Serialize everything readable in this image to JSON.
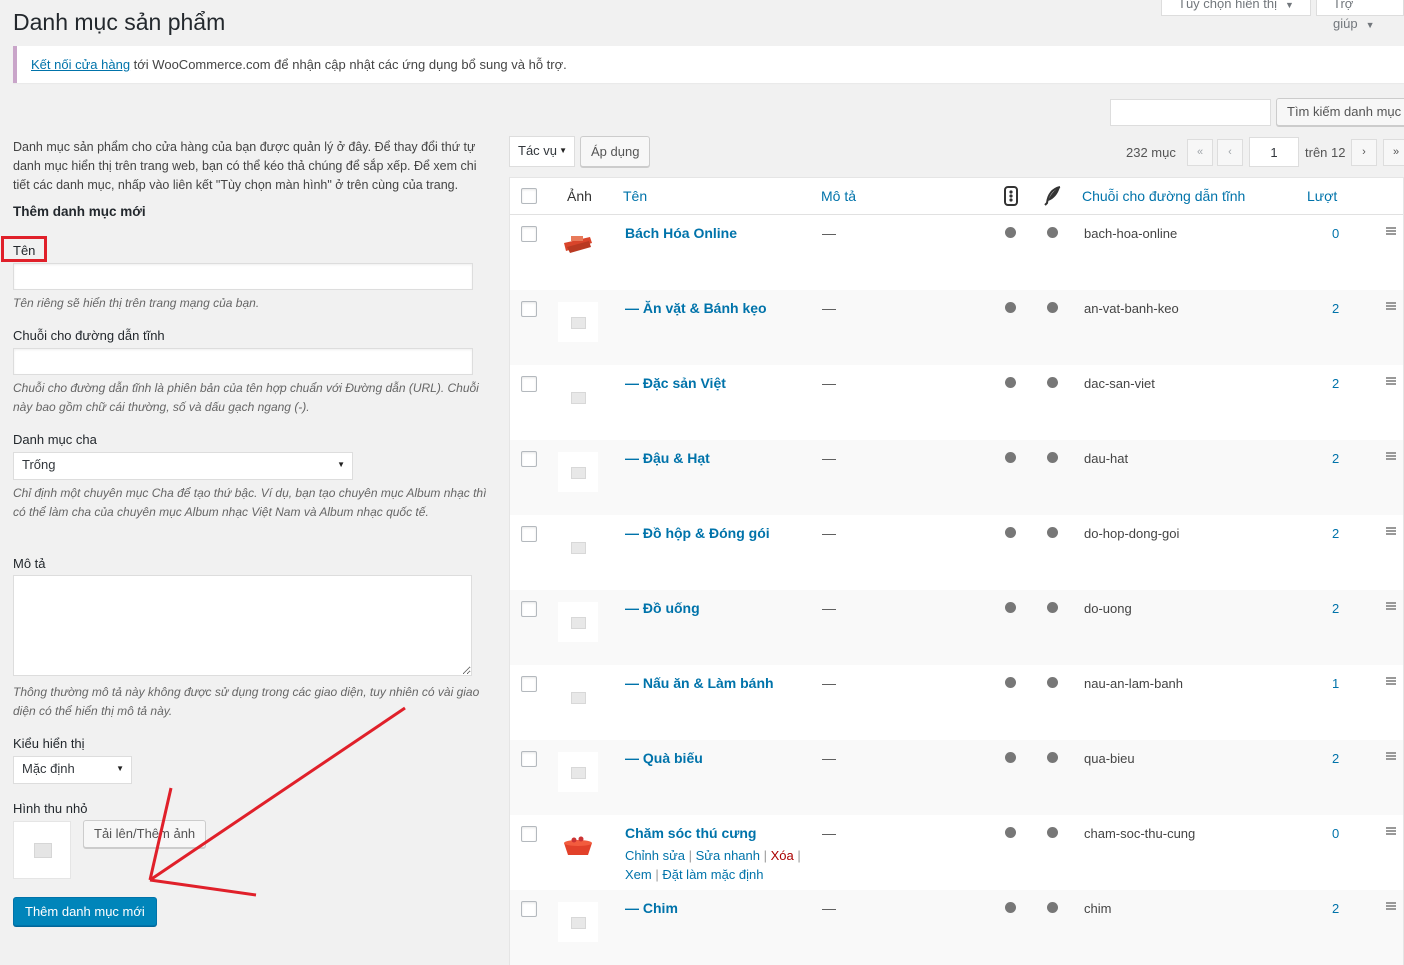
{
  "header": {
    "title": "Danh mục sản phẩm",
    "screen_options_label": "Tùy chọn hiển thị",
    "help_label": "Trợ giúp"
  },
  "notice": {
    "link": "Kết nối cửa hàng",
    "text": " tới WooCommerce.com để nhận cập nhật các ứng dụng bổ sung và hỗ trợ."
  },
  "search": {
    "placeholder": "",
    "button": "Tìm kiếm danh mục"
  },
  "form": {
    "intro": "Danh mục sản phẩm cho cửa hàng của bạn được quản lý ở đây. Để thay đổi thứ tự danh mục hiển thị trên trang web, bạn có thể kéo thả chúng để sắp xếp. Để xem chi tiết các danh mục, nhấp vào liên kết \"Tùy chọn màn hình\" ở trên cùng của trang.",
    "title": "Thêm danh mục mới",
    "name_label": "Tên",
    "name_hint": "Tên riêng sẽ hiển thị trên trang mạng của bạn.",
    "slug_label": "Chuỗi cho đường dẫn tĩnh",
    "slug_hint": "Chuỗi cho đường dẫn tĩnh là phiên bản của tên hợp chuẩn với Đường dẫn (URL). Chuỗi này bao gồm chữ cái thường, số và dấu gạch ngang (-).",
    "parent_label": "Danh mục cha",
    "parent_value": "Trống",
    "parent_hint": "Chỉ định một chuyên mục Cha để tạo thứ bậc. Ví dụ, bạn tạo chuyên mục Album nhạc thì có thể làm cha của chuyên mục Album nhạc Việt Nam và Album nhạc quốc tế.",
    "desc_label": "Mô tả",
    "desc_hint": "Thông thường mô tả này không được sử dụng trong các giao diện, tuy nhiên có vài giao diện có thể hiển thị mô tả này.",
    "display_label": "Kiểu hiển thị",
    "display_value": "Mặc định",
    "thumb_label": "Hình thu nhỏ",
    "upload_button": "Tải lên/Thêm ảnh",
    "submit_button": "Thêm danh mục mới"
  },
  "toolbar": {
    "bulk_action": "Tác vụ",
    "apply": "Áp dụng",
    "items_count": "232 mục",
    "first": "«",
    "prev": "‹",
    "page": "1",
    "of_pages": "trên 12",
    "next": "›",
    "last": "»"
  },
  "table": {
    "columns": {
      "image": "Ảnh",
      "name": "Tên",
      "desc": "Mô tả",
      "slug": "Chuỗi cho đường dẫn tĩnh",
      "count": "Lượt"
    },
    "rows": [
      {
        "name": "Bách Hóa Online",
        "desc": "—",
        "slug": "bach-hoa-online",
        "count": "0",
        "thumb": "basket"
      },
      {
        "name": "— Ăn vặt & Bánh kẹo",
        "desc": "—",
        "slug": "an-vat-banh-keo",
        "count": "2",
        "thumb": "placeholder"
      },
      {
        "name": "— Đặc sản Việt",
        "desc": "—",
        "slug": "dac-san-viet",
        "count": "2",
        "thumb": "placeholder"
      },
      {
        "name": "— Đậu & Hạt",
        "desc": "—",
        "slug": "dau-hat",
        "count": "2",
        "thumb": "placeholder"
      },
      {
        "name": "— Đồ hộp & Đóng gói",
        "desc": "—",
        "slug": "do-hop-dong-goi",
        "count": "2",
        "thumb": "placeholder"
      },
      {
        "name": "— Đồ uống",
        "desc": "—",
        "slug": "do-uong",
        "count": "2",
        "thumb": "placeholder"
      },
      {
        "name": "— Nấu ăn & Làm bánh",
        "desc": "—",
        "slug": "nau-an-lam-banh",
        "count": "1",
        "thumb": "placeholder"
      },
      {
        "name": "— Quà biếu",
        "desc": "—",
        "slug": "qua-bieu",
        "count": "2",
        "thumb": "placeholder"
      },
      {
        "name": "Chăm sóc thú cưng",
        "desc": "—",
        "slug": "cham-soc-thu-cung",
        "count": "0",
        "thumb": "pet-bowl"
      },
      {
        "name": "— Chim",
        "desc": "—",
        "slug": "chim",
        "count": "2",
        "thumb": "placeholder"
      }
    ],
    "row_actions": {
      "edit": "Chỉnh sửa",
      "quick_edit": "Sửa nhanh",
      "delete": "Xóa",
      "view": "Xem",
      "make_default": "Đặt làm mặc định"
    }
  },
  "colors": {
    "link": "#0073aa",
    "primary": "#0085ba",
    "highlight_box": "#e0202a",
    "arrow": "#e0202a"
  }
}
